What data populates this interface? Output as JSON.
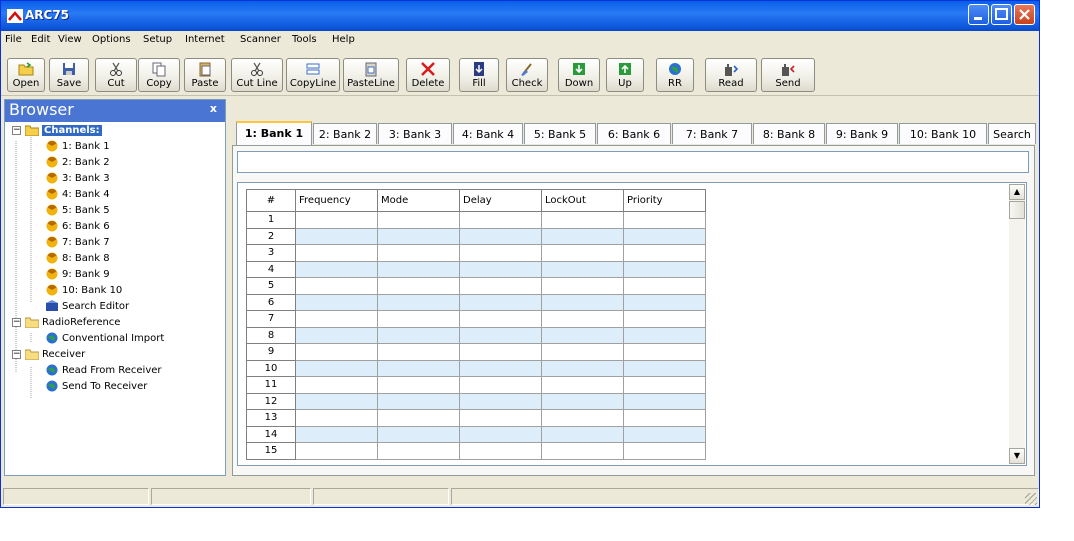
{
  "window": {
    "title": "ARC75"
  },
  "menu": [
    "File",
    "Edit",
    "View",
    "Options",
    "Setup",
    "Internet",
    "Scanner",
    "Tools",
    "Help"
  ],
  "toolbar": {
    "open": "Open",
    "save": "Save",
    "cut": "Cut",
    "copy": "Copy",
    "paste": "Paste",
    "cut_line": "Cut Line",
    "copy_line": "CopyLine",
    "paste_line": "PasteLine",
    "delete": "Delete",
    "fill": "Fill",
    "check": "Check",
    "down": "Down",
    "up": "Up",
    "rr": "RR",
    "read": "Read",
    "send": "Send"
  },
  "browser": {
    "title": "Browser",
    "close": "x",
    "channels": "Channels:",
    "banks": [
      "1: Bank 1",
      "2: Bank 2",
      "3: Bank 3",
      "4: Bank 4",
      "5: Bank 5",
      "6: Bank 6",
      "7: Bank 7",
      "8: Bank 8",
      "9: Bank 9",
      "10: Bank 10"
    ],
    "search_editor": "Search Editor",
    "radioreference": "RadioReference",
    "conventional_import": "Conventional Import",
    "receiver": "Receiver",
    "read_from_receiver": "Read From Receiver",
    "send_to_receiver": "Send To Receiver"
  },
  "tabs": [
    "1: Bank 1",
    "2: Bank 2",
    "3: Bank 3",
    "4: Bank 4",
    "5: Bank 5",
    "6: Bank 6",
    "7: Bank 7",
    "8: Bank 8",
    "9: Bank 9",
    "10: Bank 10",
    "Search"
  ],
  "grid": {
    "columns": [
      "#",
      "Frequency",
      "Mode",
      "Delay",
      "LockOut",
      "Priority"
    ],
    "rows": [
      "1",
      "2",
      "3",
      "4",
      "5",
      "6",
      "7",
      "8",
      "9",
      "10",
      "11",
      "12",
      "13",
      "14",
      "15"
    ]
  },
  "colors": {
    "title_bar": "#0a5fe8",
    "selection": "#316ac5",
    "row_alt": "#ddeefa",
    "active_tab_accent": "#ffc83c"
  }
}
